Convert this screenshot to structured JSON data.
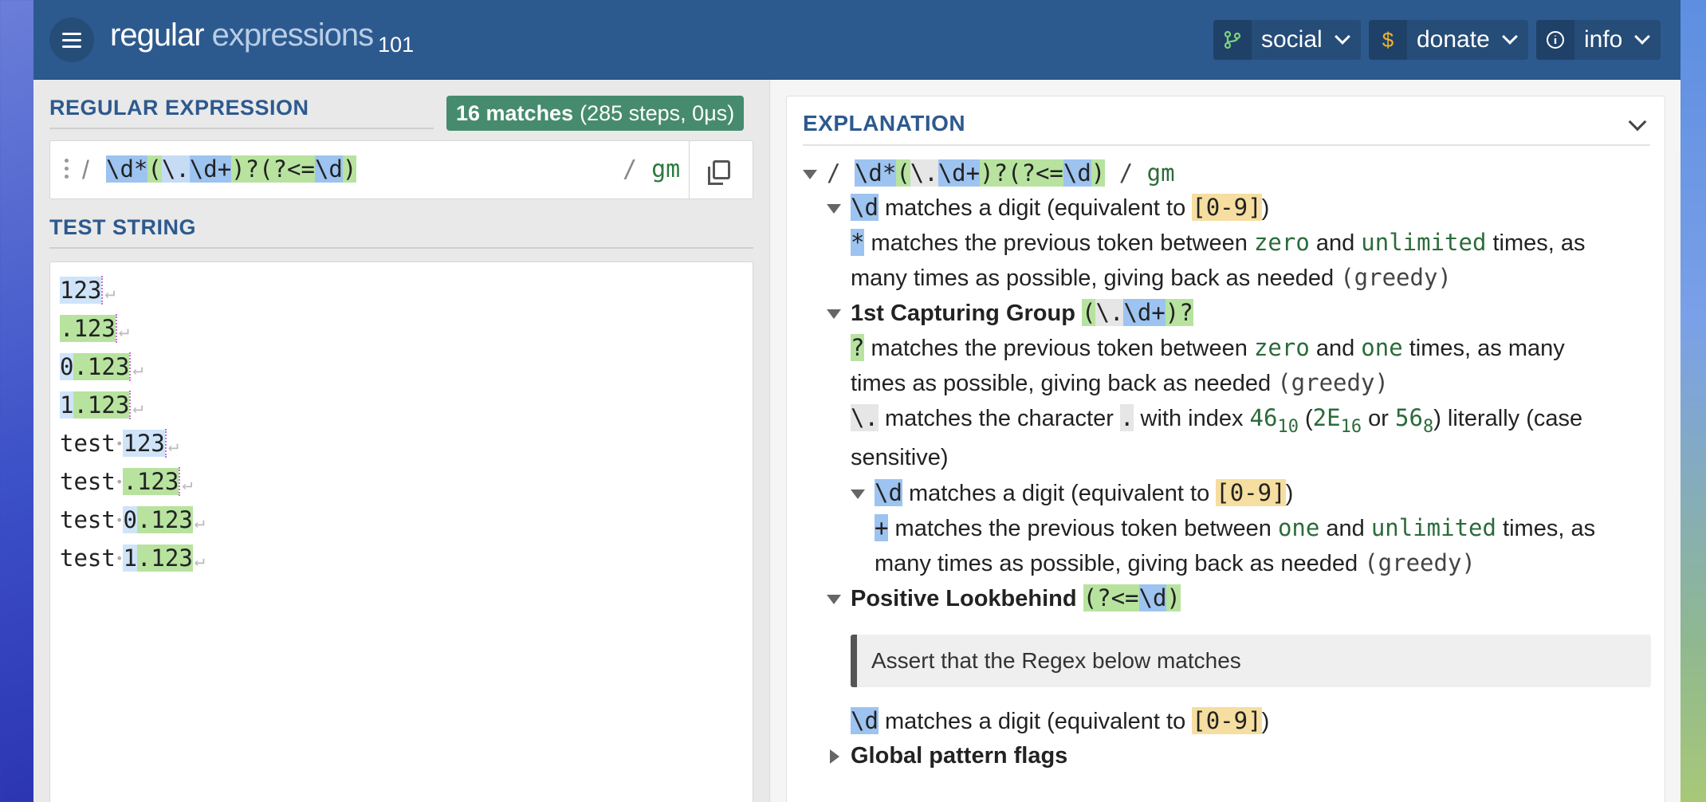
{
  "header": {
    "brand_main": "regular",
    "brand_second": "expressions",
    "brand_suffix": "101",
    "buttons": [
      {
        "label": "social",
        "icon": "git-branch-icon"
      },
      {
        "label": "donate",
        "icon": "dollar-icon"
      },
      {
        "label": "info",
        "icon": "info-icon"
      }
    ]
  },
  "regex_section": {
    "title": "REGULAR EXPRESSION",
    "match_count": "16 matches",
    "match_detail": "(285 steps, 0μs)",
    "delimiter_open": "/",
    "pattern_parts": [
      "\\d",
      "*",
      "(",
      "\\.",
      "\\d",
      "+",
      ")?",
      "(?<=",
      "\\d",
      ")"
    ],
    "delimiter_close": "/",
    "flags": "gm"
  },
  "test_section": {
    "title": "TEST STRING",
    "lines": [
      "123",
      ".123",
      "0.123",
      "1.123",
      "test 123",
      "test .123",
      "test 0.123",
      "test 1.123"
    ]
  },
  "explanation": {
    "title": "EXPLANATION",
    "root_slash": "/",
    "root_flags": "gm",
    "items": {
      "digit_desc": "matches a digit (equivalent to",
      "digit_class": "[0-9]",
      "star_desc_1": "matches the previous token between",
      "zero": "zero",
      "and": "and",
      "unlimited": "unlimited",
      "times_as": "times, as",
      "star_desc_2": "many times as possible, giving back as needed",
      "greedy": "(greedy)",
      "group1_title": "1st Capturing Group",
      "q_desc_1": "matches the previous token between",
      "one": "one",
      "times_as_many": "times, as many",
      "q_desc_2": "times as possible, giving back as needed",
      "dot_desc_1": "matches the character",
      "dot_char": ".",
      "dot_desc_2": "with index",
      "idx_dec": "46",
      "idx_dec_base": "10",
      "idx_hex": "2E",
      "idx_hex_base": "16",
      "or": "or",
      "idx_oct": "56",
      "idx_oct_base": "8",
      "dot_desc_3": ") literally (case",
      "dot_desc_4": "sensitive)",
      "plus_desc_2": "many times as possible, giving back as needed",
      "lookbehind_title": "Positive Lookbehind",
      "assert_text": "Assert that the Regex below matches",
      "global_flags": "Global pattern flags"
    }
  },
  "colors": {
    "header_bg": "#2d5a8e",
    "match_badge": "#468b6e",
    "token_blue": "#9dc3f0",
    "token_green": "#b7e39f",
    "token_yellow": "#f5dea0"
  }
}
